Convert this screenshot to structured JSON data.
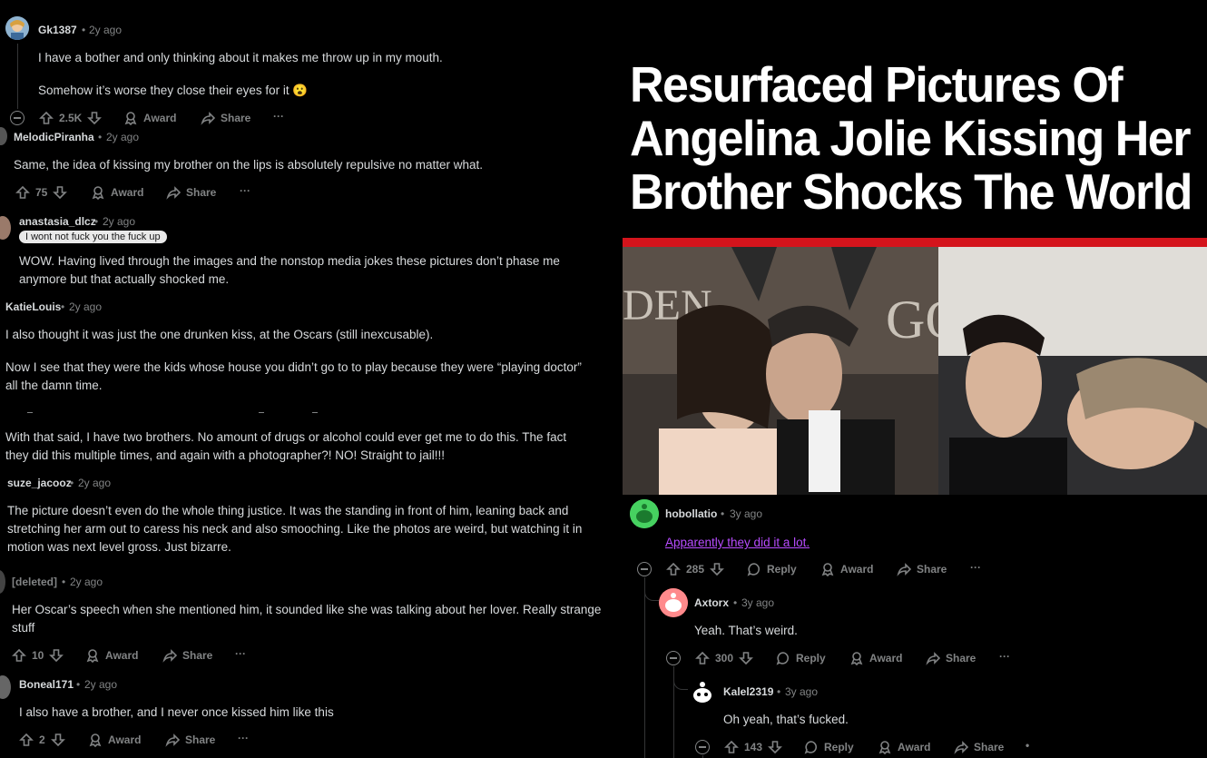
{
  "left": {
    "comments": [
      {
        "user": "Gk1387",
        "time": "2y ago",
        "lines": [
          "I have a bother and only thinking about it makes me throw up in my mouth.",
          "Somehow it’s worse they close their eyes for it 😮"
        ],
        "votes": "2.5K",
        "award": "Award",
        "share": "Share"
      },
      {
        "user": "MelodicPiranha",
        "time": "2y ago",
        "lines": [
          "Same, the idea of kissing my brother on the lips is absolutely repulsive no matter what."
        ],
        "votes": "75",
        "award": "Award",
        "share": "Share"
      },
      {
        "user": "anastasia_dlcz",
        "time": "2y ago",
        "flair": "I wont not fuck you the fuck up",
        "lines": [
          "WOW. Having lived through the images and the nonstop media jokes these pictures don’t phase me anymore but that actually shocked me."
        ]
      },
      {
        "user": "KatieLouis",
        "time": "2y ago",
        "lines": [
          "I also thought it was just the one drunken kiss, at the Oscars (still inexcusable).",
          "Now I see that they were the kids whose house you didn’t go to to play because they were “playing doctor” all the damn time.",
          "With that said, I have two brothers. No amount of drugs or alcohol could ever get me to do this. The fact they did this multiple times, and again with a photographer?! NO! Straight to jail!!!"
        ]
      },
      {
        "user": "suze_jacooz",
        "time": "2y ago",
        "lines": [
          "The picture doesn’t even do the whole thing justice. It was the standing in front of him, leaning back and stretching her arm out to caress his neck and also smooching. Like the photos are weird, but watching it in motion was next level gross. Just bizarre."
        ]
      },
      {
        "user": "[deleted]",
        "time": "2y ago",
        "lines": [
          "Her Oscar’s speech when she mentioned him, it sounded like she was talking about her lover. Really strange stuff"
        ],
        "votes": "10",
        "award": "Award",
        "share": "Share"
      },
      {
        "user": "Boneal171",
        "time": "2y ago",
        "lines": [
          "I also have a brother, and I never once kissed him like this"
        ],
        "votes": "2",
        "award": "Award",
        "share": "Share"
      }
    ]
  },
  "right": {
    "headline": [
      "Resurfaced Pictures Of",
      "Angelina Jolie Kissing Her",
      "Brother Shocks The World"
    ],
    "comments": [
      {
        "user": "hobollatio",
        "time": "3y ago",
        "link": "Apparently they did it a lot.",
        "votes": "285",
        "reply": "Reply",
        "award": "Award",
        "share": "Share"
      },
      {
        "user": "Axtorx",
        "time": "3y ago",
        "text": "Yeah. That’s weird.",
        "votes": "300",
        "reply": "Reply",
        "award": "Award",
        "share": "Share"
      },
      {
        "user": "Kalel2319",
        "time": "3y ago",
        "text": "Oh yeah, that’s fucked.",
        "votes": "143",
        "reply": "Reply",
        "award": "Award",
        "share": "Share"
      }
    ]
  },
  "separator": "•",
  "more": "···"
}
